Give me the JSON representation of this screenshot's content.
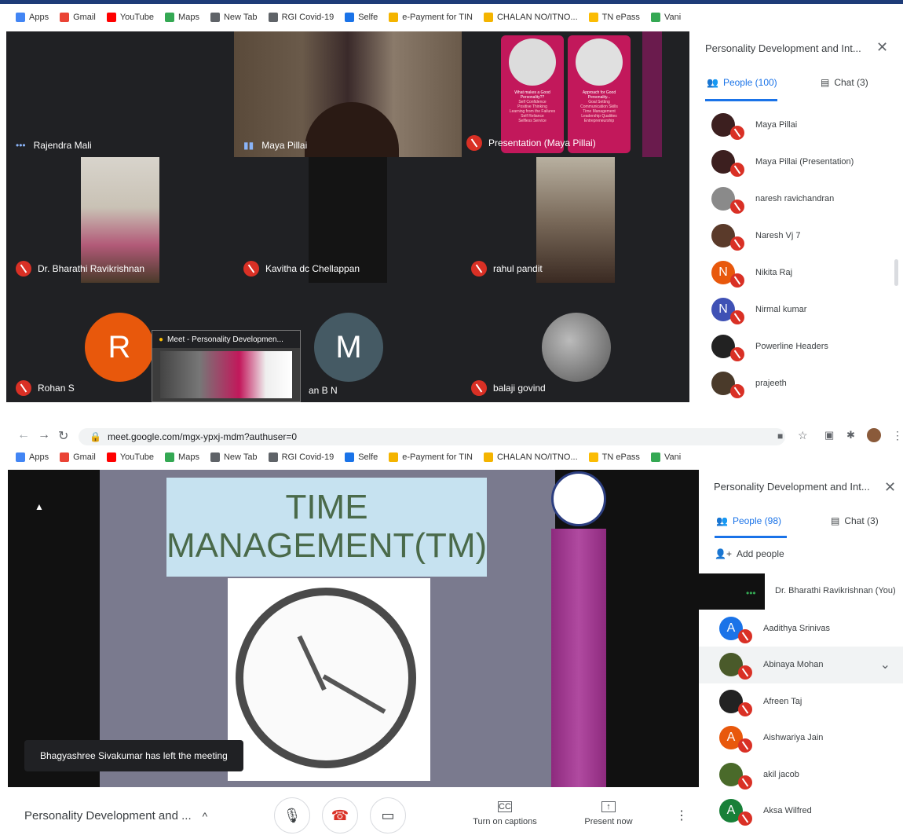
{
  "bookmarks": [
    "Apps",
    "Gmail",
    "YouTube",
    "Maps",
    "New Tab",
    "RGI Covid-19",
    "Selfe",
    "e-Payment for TIN",
    "CHALAN NO/ITNO...",
    "TN ePass",
    "Vani"
  ],
  "bookmark_colors": [
    "#4285f4",
    "#ea4335",
    "#ff0000",
    "#34a853",
    "#5f6368",
    "#5f6368",
    "#1a73e8",
    "#f4b400",
    "#f4b400",
    "#fbbc04",
    "#34a853"
  ],
  "top": {
    "tiles": [
      {
        "name": "Rajendra Mali"
      },
      {
        "name": "Maya Pillai"
      },
      {
        "name": "Presentation (Maya Pillai)"
      },
      {
        "name": "Dr. Bharathi Ravikrishnan"
      },
      {
        "name": "Kavitha dc Chellappan"
      },
      {
        "name": "rahul pandit"
      },
      {
        "name": "Rohan S",
        "initial": "R"
      },
      {
        "name": "an B N",
        "initial": "M"
      },
      {
        "name": "balaji govind"
      }
    ],
    "slide_left_title": "What makes a Good Personality??",
    "slide_left_lines": [
      "Self Confidence",
      "Positive Thinking",
      "Learning from the Failures",
      "Self Reliance",
      "Selfless Service"
    ],
    "slide_right_title": "Approach for Good Personality...",
    "slide_right_lines": [
      "Goal Setting",
      "Communication Skills",
      "Time Management",
      "Leadership Qualities",
      "Entrepreneurship"
    ],
    "pip_title": "Meet - Personality Developmen...",
    "panel": {
      "title": "Personality Development and Int...",
      "people_tab": "People (100)",
      "chat_tab": "Chat (3)",
      "people": [
        {
          "name": "Maya Pillai",
          "color": "#3c1f1f",
          "initial": ""
        },
        {
          "name": "Maya Pillai (Presentation)",
          "color": "#3c1f1f",
          "initial": ""
        },
        {
          "name": "naresh ravichandran",
          "color": "#8a8a8a",
          "initial": ""
        },
        {
          "name": "Naresh Vj 7",
          "color": "#5a3a2a",
          "initial": ""
        },
        {
          "name": "Nikita Raj",
          "color": "#e8580c",
          "initial": "N"
        },
        {
          "name": "Nirmal kumar",
          "color": "#3f51b5",
          "initial": "N"
        },
        {
          "name": "Powerline Headers",
          "color": "#222",
          "initial": ""
        },
        {
          "name": "prajeeth",
          "color": "#4a3a2a",
          "initial": ""
        }
      ]
    }
  },
  "bottom": {
    "url": "meet.google.com/mgx-ypxj-mdm?authuser=0",
    "slide_title_line1": "TIME",
    "slide_title_line2": "MANAGEMENT(TM)",
    "toast": "Bhagyashree Sivakumar has left the meeting",
    "meeting_title": "Personality Development and ...",
    "captions_label": "Turn on captions",
    "present_label": "Present now",
    "panel": {
      "title": "Personality Development and Int...",
      "people_tab": "People (98)",
      "chat_tab": "Chat (3)",
      "add_people": "Add people",
      "self_name": "Dr. Bharathi Ravikrishnan (You)",
      "people": [
        {
          "name": "Aadithya Srinivas",
          "color": "#1a73e8",
          "initial": "A"
        },
        {
          "name": "Abinaya Mohan",
          "color": "#4a5a2a",
          "initial": ""
        },
        {
          "name": "Afreen Taj",
          "color": "#222",
          "initial": ""
        },
        {
          "name": "Aishwariya Jain",
          "color": "#e8580c",
          "initial": "A"
        },
        {
          "name": "akil jacob",
          "color": "#4a6a2a",
          "initial": ""
        },
        {
          "name": "Aksa Wilfred",
          "color": "#188038",
          "initial": "A"
        }
      ]
    }
  }
}
